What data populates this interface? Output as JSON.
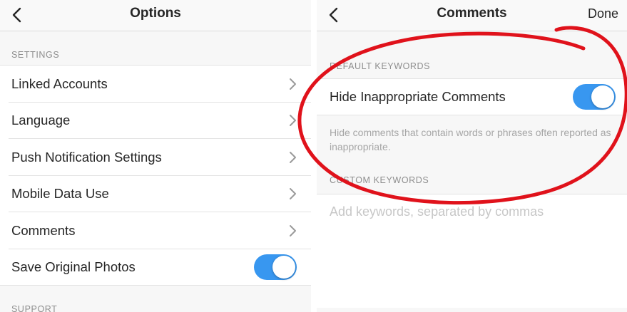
{
  "left": {
    "nav": {
      "title": "Options",
      "back_icon": "chevron-left-icon"
    },
    "settings_header": "SETTINGS",
    "items": [
      {
        "label": "Linked Accounts",
        "accessory": "chevron-right-icon"
      },
      {
        "label": "Language",
        "accessory": "chevron-right-icon"
      },
      {
        "label": "Push Notification Settings",
        "accessory": "chevron-right-icon"
      },
      {
        "label": "Mobile Data Use",
        "accessory": "chevron-right-icon"
      },
      {
        "label": "Comments",
        "accessory": "chevron-right-icon"
      },
      {
        "label": "Save Original Photos",
        "accessory": "toggle",
        "toggle_on": true
      }
    ],
    "support_header": "SUPPORT"
  },
  "right": {
    "nav": {
      "title": "Comments",
      "done_label": "Done",
      "back_icon": "chevron-left-icon"
    },
    "default_header": "DEFAULT KEYWORDS",
    "hide_label": "Hide Inappropriate Comments",
    "hide_toggle_on": true,
    "description": "Hide comments that contain words or phrases often reported as inappropriate.",
    "custom_header": "CUSTOM KEYWORDS",
    "keywords_placeholder": "Add keywords, separated by commas",
    "keywords_value": ""
  },
  "colors": {
    "toggle_on": "#3897f0",
    "annotation": "#e0121b",
    "background": "#f7f7f7",
    "muted_text": "#8e8e8e"
  }
}
